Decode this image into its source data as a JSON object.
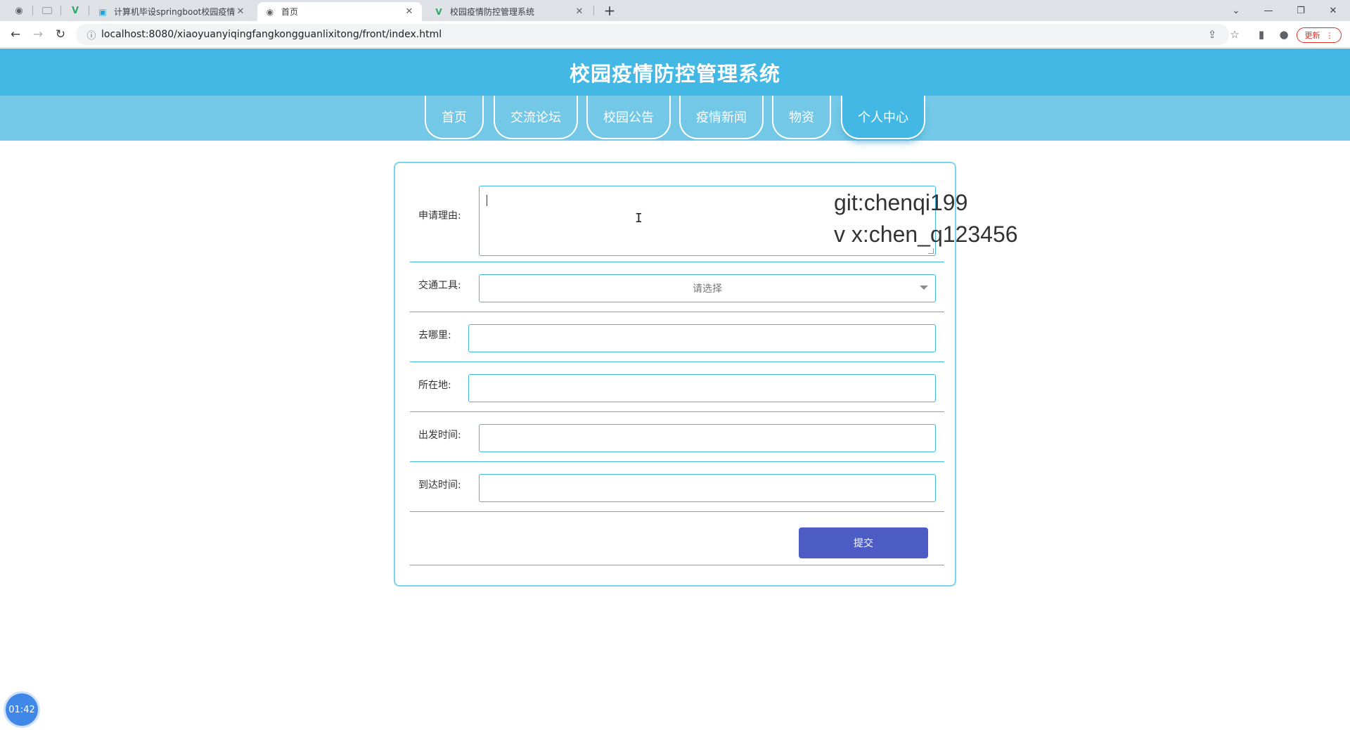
{
  "browser": {
    "pinned_icons": [
      "globe-icon",
      "blank-page-icon",
      "vue-icon"
    ],
    "tabs": [
      {
        "label": "计算机毕设springboot校园疫情",
        "icon": "bilibili-icon"
      },
      {
        "label": "首页",
        "icon": "globe-icon"
      },
      {
        "label": "校园疫情防控管理系统",
        "icon": "vue-icon"
      }
    ],
    "new_tab": "+",
    "url": "localhost:8080/xiaoyuanyiqingfangkongguanlixitong/front/index.html",
    "update_label": "更新"
  },
  "site": {
    "title": "校园疫情防控管理系统",
    "nav": [
      "首页",
      "交流论坛",
      "校园公告",
      "疫情新闻",
      "物资",
      "个人中心"
    ],
    "active_nav": "个人中心",
    "header_color": "#43b8e4",
    "strip_color": "#72c8e6"
  },
  "form": {
    "reason_label": "申请理由:",
    "reason_value": "",
    "transport_label": "交通工具:",
    "transport_placeholder": "请选择",
    "destination_label": "去哪里:",
    "destination_value": "",
    "location_label": "所在地:",
    "location_value": "",
    "depart_label": "出发时间:",
    "depart_value": "",
    "arrive_label": "到达时间:",
    "arrive_value": "",
    "submit_label": "提交",
    "submit_color": "#4e5cc5"
  },
  "overlay": {
    "watermark_line1": "git:chenqi199",
    "watermark_line2": "v x:chen_q123456",
    "timer": "01:42"
  }
}
